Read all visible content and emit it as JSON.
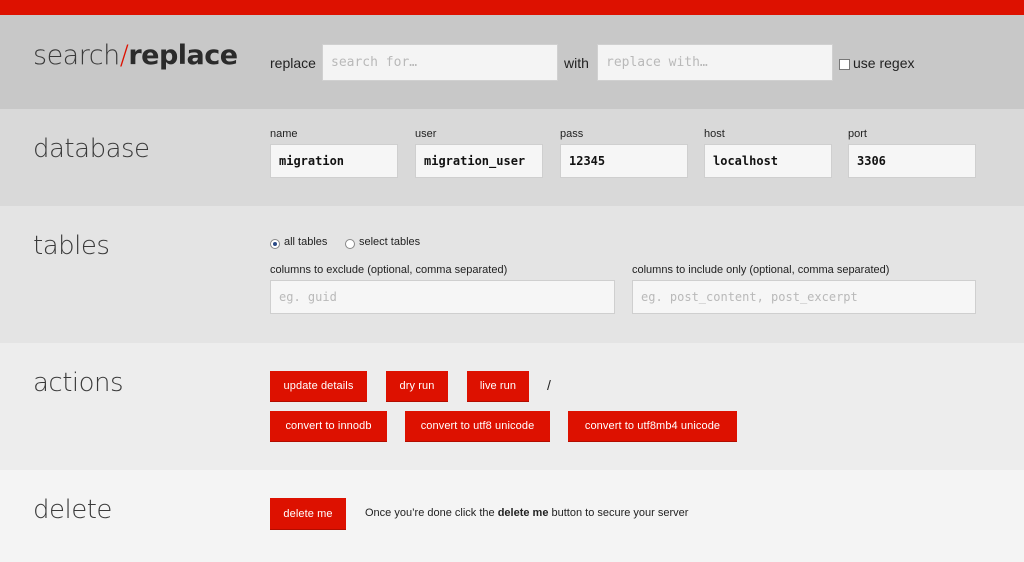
{
  "colors": {
    "accent": "#dd1100"
  },
  "brand": {
    "part1": "search",
    "slash": "/",
    "part2": "replace"
  },
  "search": {
    "replace_label": "replace",
    "search_placeholder": "search for…",
    "with_label": "with",
    "replace_placeholder": "replace with…",
    "regex_label": "use regex",
    "regex_checked": false
  },
  "database": {
    "heading": "database",
    "fields": [
      {
        "label": "name",
        "value": "migration"
      },
      {
        "label": "user",
        "value": "migration_user"
      },
      {
        "label": "pass",
        "value": "12345"
      },
      {
        "label": "host",
        "value": "localhost"
      },
      {
        "label": "port",
        "value": "3306"
      }
    ]
  },
  "tables": {
    "heading": "tables",
    "radio_all": "all tables",
    "radio_select": "select tables",
    "selected": "all tables",
    "exclude_label": "columns to exclude (optional, comma separated)",
    "exclude_placeholder": "eg. guid",
    "include_label": "columns to include only (optional, comma separated)",
    "include_placeholder": "eg. post_content, post_excerpt"
  },
  "actions": {
    "heading": "actions",
    "update": "update details",
    "dry": "dry run",
    "live": "live run",
    "separator": "/",
    "innodb": "convert to innodb",
    "utf8": "convert to utf8 unicode",
    "utf8mb4": "convert to utf8mb4 unicode"
  },
  "delete": {
    "heading": "delete",
    "button": "delete me",
    "note_before": "Once you’re done click the ",
    "note_bold": "delete me",
    "note_after": " button to secure your server"
  }
}
